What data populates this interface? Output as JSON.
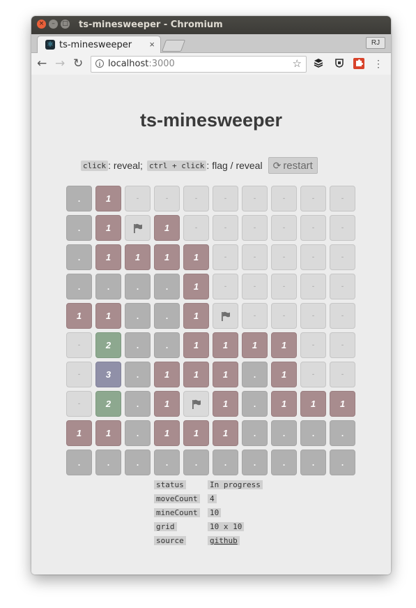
{
  "window": {
    "title": "ts-minesweeper - Chromium"
  },
  "tab": {
    "label": "ts-minesweeper",
    "close": "×"
  },
  "profile": {
    "initials": "RJ"
  },
  "nav": {
    "back": "←",
    "forward": "→",
    "reload": "↻"
  },
  "omnibox": {
    "host": "localhost",
    "port": ":3000",
    "star": "☆"
  },
  "page": {
    "title": "ts-minesweeper",
    "hint_click": "click",
    "hint_reveal": ": reveal;",
    "hint_ctrl_click": "ctrl + click",
    "hint_flag": ": flag / reveal",
    "restart_icon": "⟳",
    "restart_label": "restart"
  },
  "board": {
    "rows": 10,
    "cols": 10,
    "cells": [
      [
        ".",
        "1",
        "-",
        "-",
        "-",
        "-",
        "-",
        "-",
        "-",
        "-"
      ],
      [
        ".",
        "1",
        "F",
        "1",
        "-",
        "-",
        "-",
        "-",
        "-",
        "-"
      ],
      [
        ".",
        "1",
        "1",
        "1",
        "1",
        "-",
        "-",
        "-",
        "-",
        "-"
      ],
      [
        ".",
        ".",
        ".",
        ".",
        "1",
        "-",
        "-",
        "-",
        "-",
        "-"
      ],
      [
        "1",
        "1",
        ".",
        ".",
        "1",
        "F",
        "-",
        "-",
        "-",
        "-"
      ],
      [
        "-",
        "2",
        ".",
        ".",
        "1",
        "1",
        "1",
        "1",
        "-",
        "-"
      ],
      [
        "-",
        "3",
        ".",
        "1",
        "1",
        "1",
        ".",
        "1",
        "-",
        "-"
      ],
      [
        "-",
        "2",
        ".",
        "1",
        "F",
        "1",
        ".",
        "1",
        "1",
        "1"
      ],
      [
        "1",
        "1",
        ".",
        "1",
        "1",
        "1",
        ".",
        ".",
        ".",
        "."
      ],
      [
        ".",
        ".",
        ".",
        ".",
        ".",
        ".",
        ".",
        ".",
        ".",
        "."
      ]
    ],
    "hidden_glyph": "-",
    "revealed_glyph": ".",
    "flag_icon": "flag-icon"
  },
  "stats": [
    {
      "key": "status",
      "value": "In progress"
    },
    {
      "key": "moveCount",
      "value": "4"
    },
    {
      "key": "mineCount",
      "value": "10"
    },
    {
      "key": "grid",
      "value": "10 x 10"
    },
    {
      "key": "source",
      "value": "github"
    }
  ],
  "colors": {
    "hidden": "#dadada",
    "revealed": "#b1b1b1",
    "one": "#a88c8e",
    "two": "#8da88f",
    "three": "#9090a8"
  }
}
